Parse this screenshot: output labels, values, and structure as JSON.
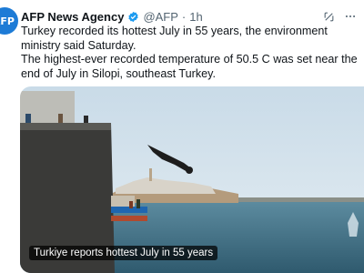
{
  "tweet": {
    "avatar_text": "AFP",
    "author_name": "AFP News Agency",
    "handle": "@AFP",
    "separator": "·",
    "time": "1h",
    "lines": [
      "Turkey recorded its hottest July in 55 years, the environment ministry said Saturday.",
      "The highest-ever recorded temperature of 50.5 C was set near the end of July in Silopi, southeast Turkey."
    ],
    "media_caption": "Turkiye reports hottest July in 55 years"
  },
  "colors": {
    "accent": "#1d9bf0",
    "text": "#0f1419",
    "muted": "#536471"
  },
  "icons": {
    "verified": "verified-badge-icon",
    "grok": "grok-icon",
    "more": "more-icon"
  }
}
